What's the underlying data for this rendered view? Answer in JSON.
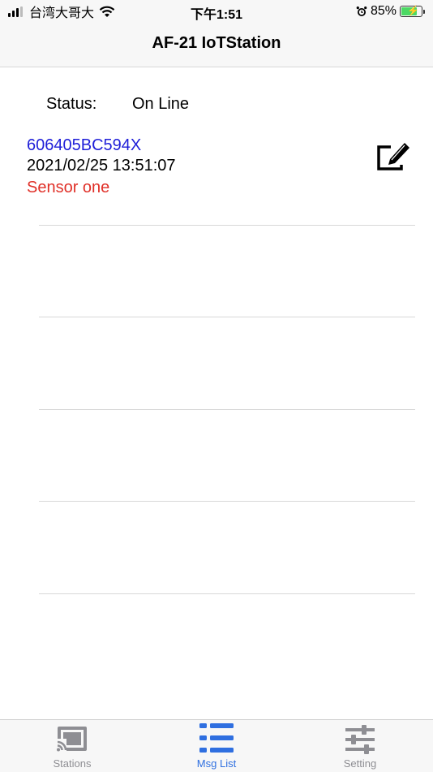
{
  "status_bar": {
    "carrier": "台湾大哥大",
    "time": "下午1:51",
    "battery_percent": "85%",
    "battery_level": 0.85,
    "icons": [
      "signal-icon",
      "wifi-icon",
      "alarm-icon",
      "battery-charging-icon"
    ]
  },
  "header": {
    "title": "AF-21 IoTStation"
  },
  "status": {
    "label": "Status:",
    "value": "On Line"
  },
  "entries": [
    {
      "id": "606405BC594X",
      "datetime": "2021/02/25 13:51:07",
      "name": "Sensor one"
    }
  ],
  "tabs": [
    {
      "label": "Stations",
      "icon": "cast-icon",
      "active": false
    },
    {
      "label": "Msg List",
      "icon": "list-icon",
      "active": true
    },
    {
      "label": "Setting",
      "icon": "sliders-icon",
      "active": false
    }
  ],
  "colors": {
    "link_blue": "#1e1ed8",
    "alert_red": "#e03028",
    "tab_active": "#2f6fe0",
    "tab_inactive": "#8e8e93"
  }
}
